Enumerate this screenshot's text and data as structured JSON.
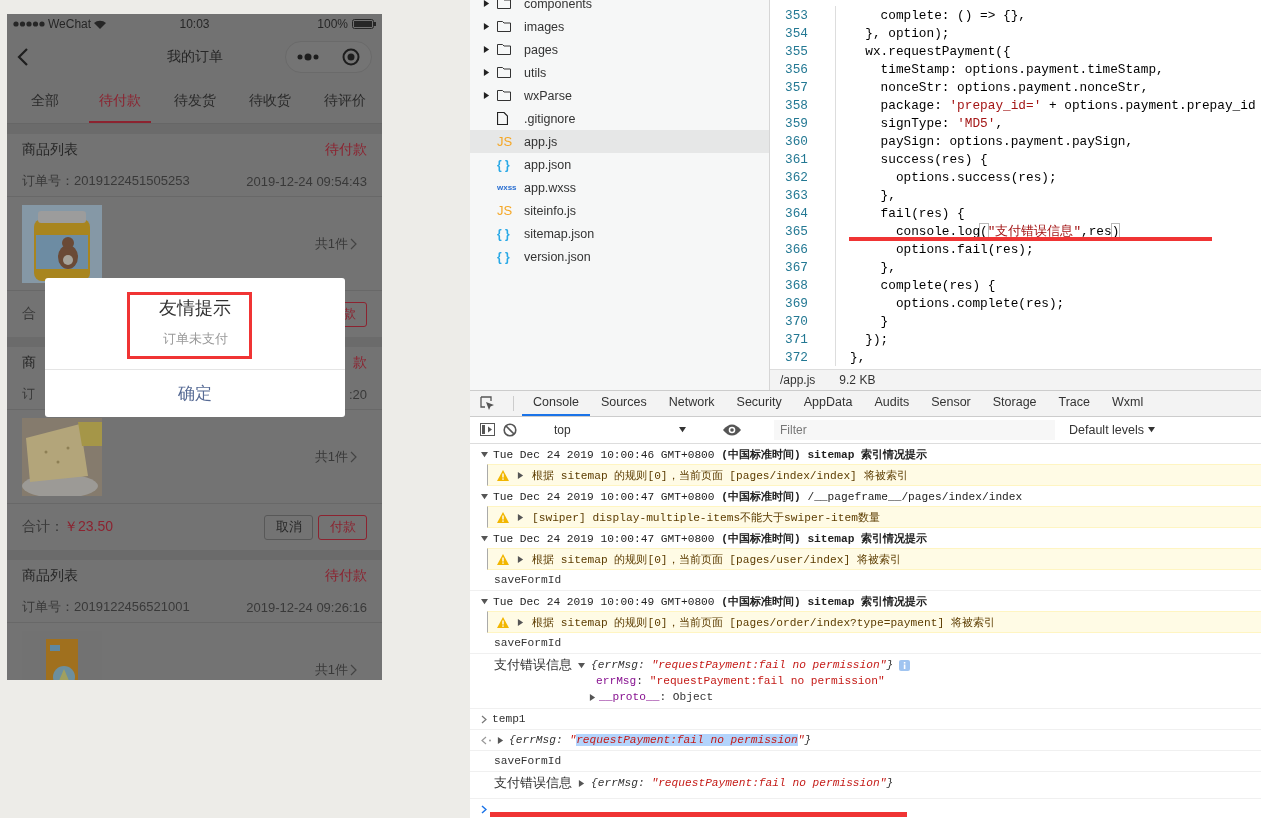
{
  "phone": {
    "status_bar": {
      "carrier": "WeChat",
      "time": "10:03",
      "battery": "100%"
    },
    "nav": {
      "title": "我的订单"
    },
    "tabs": [
      {
        "label": "全部",
        "selected": false
      },
      {
        "label": "待付款",
        "selected": true
      },
      {
        "label": "待发货",
        "selected": false
      },
      {
        "label": "待收货",
        "selected": false
      },
      {
        "label": "待评价",
        "selected": false
      }
    ],
    "orders": [
      {
        "title": "商品列表",
        "status": "待付款",
        "order_no": "订单号：2019122451505253",
        "time": "2019-12-24 09:54:43",
        "quantity": "共1件",
        "total_label": "合",
        "buttons": [
          {
            "label": "款",
            "kind": "pay"
          }
        ]
      },
      {
        "title": "商",
        "status": "款",
        "order_no": "订",
        "time": ":20",
        "quantity": "共1件",
        "total_label": "合计：",
        "total": "￥23.50",
        "buttons": [
          {
            "label": "取消",
            "kind": "cancel"
          },
          {
            "label": "付款",
            "kind": "pay"
          }
        ]
      },
      {
        "title": "商品列表",
        "status": "待付款",
        "order_no": "订单号：2019122456521001",
        "time": "2019-12-24 09:26:16",
        "quantity": "共1件"
      }
    ],
    "dialog": {
      "title": "友情提示",
      "message": "订单未支付",
      "confirm": "确定"
    }
  },
  "file_tree": [
    {
      "name": "components",
      "kind": "folder",
      "expanded": false,
      "selected": false
    },
    {
      "name": "images",
      "kind": "folder",
      "expanded": false,
      "selected": false
    },
    {
      "name": "pages",
      "kind": "folder",
      "expanded": false,
      "selected": false
    },
    {
      "name": "utils",
      "kind": "folder",
      "expanded": false,
      "selected": false
    },
    {
      "name": "wxParse",
      "kind": "folder",
      "expanded": false,
      "selected": false
    },
    {
      "name": ".gitignore",
      "kind": "file",
      "selected": false
    },
    {
      "name": "app.js",
      "kind": "js",
      "badge": "JS",
      "selected": true
    },
    {
      "name": "app.json",
      "kind": "json",
      "badge": "{ }",
      "selected": false
    },
    {
      "name": "app.wxss",
      "kind": "wxss",
      "badge": "wxss",
      "selected": false
    },
    {
      "name": "siteinfo.js",
      "kind": "js",
      "badge": "JS",
      "selected": false
    },
    {
      "name": "sitemap.json",
      "kind": "json",
      "badge": "{ }",
      "selected": false
    },
    {
      "name": "version.json",
      "kind": "json",
      "badge": "{ }",
      "selected": false
    }
  ],
  "code": {
    "lines": [
      {
        "number": "353",
        "tokens": [
          {
            "text": "    complete: () => {},",
            "kind": "plain"
          }
        ]
      },
      {
        "number": "354",
        "tokens": [
          {
            "text": "  }, option);",
            "kind": "plain"
          }
        ]
      },
      {
        "number": "355",
        "tokens": [
          {
            "text": "  wx.requestPayment({",
            "kind": "plain"
          }
        ]
      },
      {
        "number": "356",
        "tokens": [
          {
            "text": "    timeStamp: options.payment.timeStamp,",
            "kind": "plain"
          }
        ]
      },
      {
        "number": "357",
        "tokens": [
          {
            "text": "    nonceStr: options.payment.nonceStr,",
            "kind": "plain"
          }
        ]
      },
      {
        "number": "358",
        "tokens": [
          {
            "text": "    package: ",
            "kind": "plain"
          },
          {
            "text": "'prepay_id='",
            "kind": "string"
          },
          {
            "text": " + options.payment.prepay_id",
            "kind": "plain"
          }
        ]
      },
      {
        "number": "359",
        "tokens": [
          {
            "text": "    signType: ",
            "kind": "plain"
          },
          {
            "text": "'MD5'",
            "kind": "string"
          },
          {
            "text": ",",
            "kind": "plain"
          }
        ]
      },
      {
        "number": "360",
        "tokens": [
          {
            "text": "    paySign: options.payment.paySign,",
            "kind": "plain"
          }
        ]
      },
      {
        "number": "361",
        "tokens": [
          {
            "text": "    success(res) {",
            "kind": "plain"
          }
        ]
      },
      {
        "number": "362",
        "tokens": [
          {
            "text": "      options.success(res);",
            "kind": "plain"
          }
        ]
      },
      {
        "number": "363",
        "tokens": [
          {
            "text": "    },",
            "kind": "plain"
          }
        ]
      },
      {
        "number": "364",
        "tokens": [
          {
            "text": "    fail(res) {",
            "kind": "plain"
          }
        ]
      },
      {
        "number": "365",
        "tokens": [
          {
            "text": "      console.log",
            "kind": "plain"
          },
          {
            "text": "(",
            "kind": "bracket"
          },
          {
            "text": "\"支付错误信息\"",
            "kind": "string"
          },
          {
            "text": ",res",
            "kind": "plain"
          },
          {
            "text": ")",
            "kind": "bracket"
          }
        ]
      },
      {
        "number": "366",
        "tokens": [
          {
            "text": "      options.fail(res);",
            "kind": "plain"
          }
        ]
      },
      {
        "number": "367",
        "tokens": [
          {
            "text": "    },",
            "kind": "plain"
          }
        ]
      },
      {
        "number": "368",
        "tokens": [
          {
            "text": "    complete(res) {",
            "kind": "plain"
          }
        ]
      },
      {
        "number": "369",
        "tokens": [
          {
            "text": "      options.complete(res);",
            "kind": "plain"
          }
        ]
      },
      {
        "number": "370",
        "tokens": [
          {
            "text": "    }",
            "kind": "plain"
          }
        ]
      },
      {
        "number": "371",
        "tokens": [
          {
            "text": "  });",
            "kind": "plain"
          }
        ]
      },
      {
        "number": "372",
        "tokens": [
          {
            "text": "},",
            "kind": "plain"
          }
        ]
      }
    ],
    "file_info": {
      "path": "/app.js",
      "size": "9.2 KB"
    }
  },
  "devtools": {
    "tabs": [
      {
        "label": "Console",
        "selected": true
      },
      {
        "label": "Sources",
        "selected": false
      },
      {
        "label": "Network",
        "selected": false
      },
      {
        "label": "Security",
        "selected": false
      },
      {
        "label": "AppData",
        "selected": false
      },
      {
        "label": "Audits",
        "selected": false
      },
      {
        "label": "Sensor",
        "selected": false
      },
      {
        "label": "Storage",
        "selected": false
      },
      {
        "label": "Trace",
        "selected": false
      },
      {
        "label": "Wxml",
        "selected": false
      }
    ],
    "context": "top",
    "filter_placeholder": "Filter",
    "levels": "Default levels"
  },
  "console": [
    {
      "kind": "group",
      "expanded": true,
      "text": "Tue Dec 24 2019 10:00:46 GMT+0800 **(中国标准时间) sitemap 索引情况提示**"
    },
    {
      "kind": "warning",
      "expanded": false,
      "text": "根据 sitemap 的规则[0]，当前页面 [pages/index/index] 将被索引"
    },
    {
      "kind": "group",
      "expanded": true,
      "text": "Tue Dec 24 2019 10:00:47 GMT+0800 **(中国标准时间)** /__pageframe__/pages/index/index"
    },
    {
      "kind": "warning",
      "expanded": false,
      "text": "[swiper] display-multiple-items不能大于swiper-item数量"
    },
    {
      "kind": "group",
      "expanded": true,
      "text": "Tue Dec 24 2019 10:00:47 GMT+0800 **(中国标准时间) sitemap 索引情况提示**"
    },
    {
      "kind": "warning",
      "expanded": false,
      "text": "根据 sitemap 的规则[0]，当前页面 [pages/user/index] 将被索引"
    },
    {
      "kind": "log",
      "text": "saveFormId"
    },
    {
      "kind": "group",
      "expanded": true,
      "text": "Tue Dec 24 2019 10:00:49 GMT+0800 **(中国标准时间) sitemap 索引情况提示**"
    },
    {
      "kind": "warning",
      "expanded": false,
      "text": "根据 sitemap 的规则[0]，当前页面 [pages/order/index?type=payment] 将被索引"
    },
    {
      "kind": "log",
      "text": "saveFormId"
    },
    {
      "kind": "object",
      "label": "支付错误信息",
      "expanded": true,
      "preview": [
        "{errMsg: ",
        "\"",
        "requestPayment:fail no permission",
        "\"",
        "}"
      ],
      "properties": [
        [
          "errMsg",
          ": ",
          "\"requestPayment:fail no permission\""
        ],
        [
          "__proto__",
          ": Object"
        ]
      ]
    },
    {
      "kind": "input",
      "text": "temp1"
    },
    {
      "kind": "result",
      "expanded": false,
      "text_selected": true,
      "preview": [
        "{errMsg: ",
        "\"",
        "requestPayment:fail no permission",
        "\"",
        "}"
      ]
    },
    {
      "kind": "log",
      "text": "saveFormId"
    },
    {
      "kind": "object",
      "label": "支付错误信息",
      "expanded": false,
      "preview": [
        "{errMsg: ",
        "\"",
        "requestPayment:fail no permission",
        "\"",
        "}"
      ]
    },
    {
      "kind": "prompt"
    }
  ]
}
